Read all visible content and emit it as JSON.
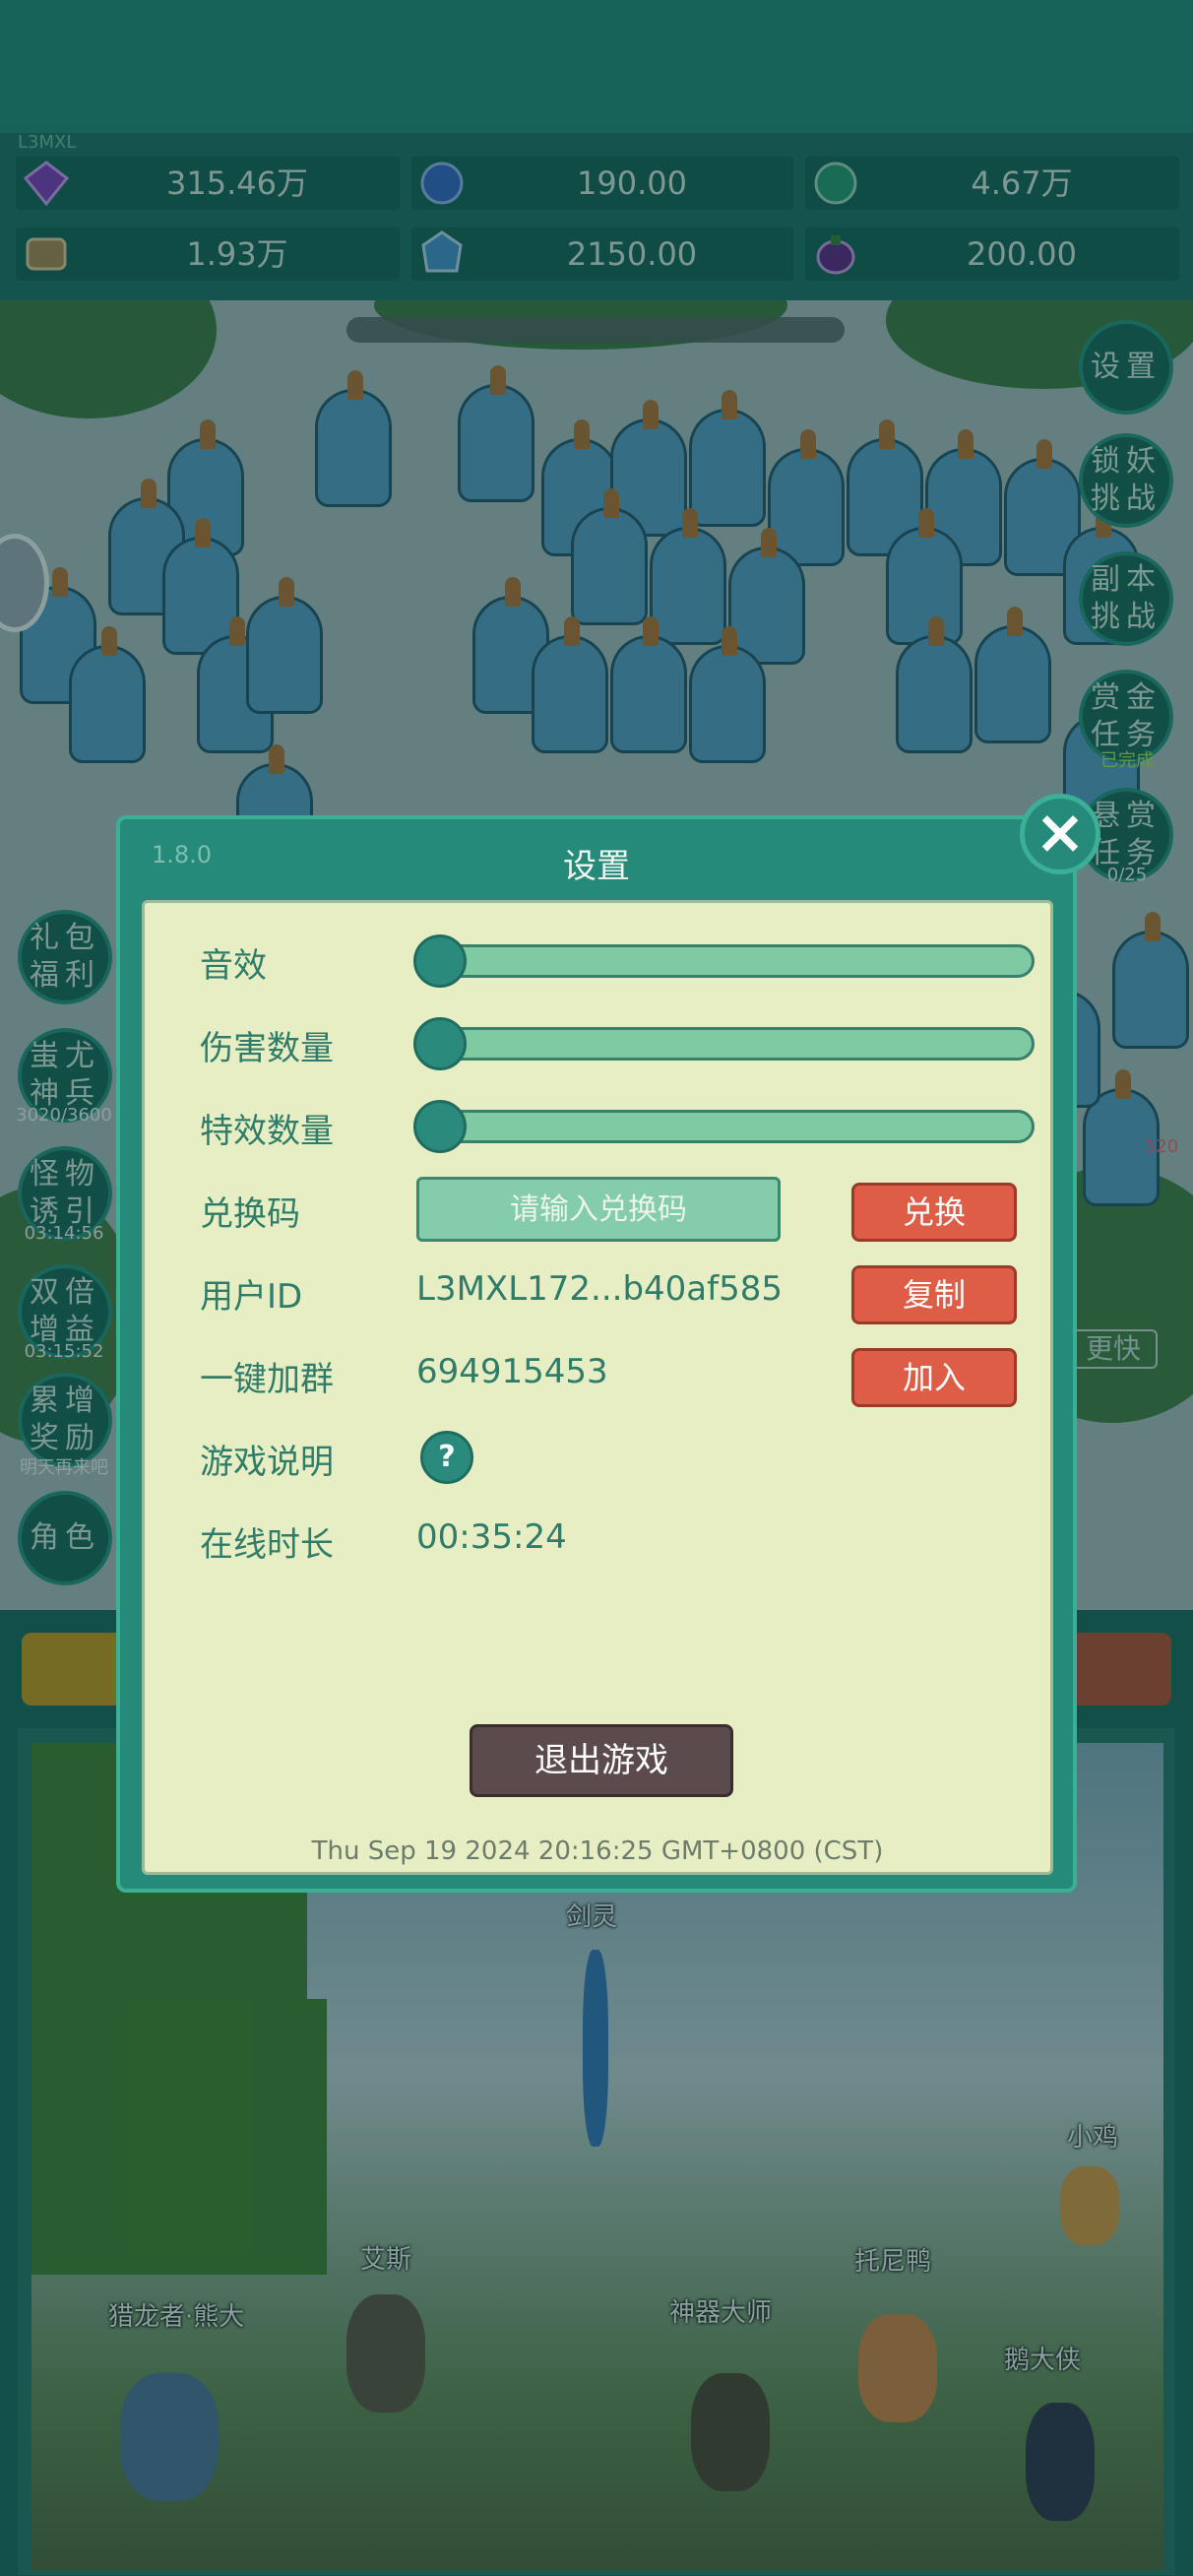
{
  "top": {
    "user_tag": "L3MXL",
    "resources": [
      {
        "name": "purple-gem",
        "value": "315.46万",
        "color": "#8a3fc7"
      },
      {
        "name": "blue-crystal",
        "value": "190.00",
        "color": "#3d6fd1"
      },
      {
        "name": "world-orb",
        "value": "4.67万",
        "color": "#2fa37a"
      },
      {
        "name": "scroll",
        "value": "1.93万",
        "color": "#b8905a"
      },
      {
        "name": "ice-crystal",
        "value": "2150.00",
        "color": "#4f9bd8"
      },
      {
        "name": "eggplant",
        "value": "200.00",
        "color": "#6a2a8a"
      }
    ]
  },
  "side_right": [
    {
      "label": "设置",
      "sub": ""
    },
    {
      "label": "锁妖挑战",
      "sub": ""
    },
    {
      "label": "副本挑战",
      "sub": ""
    },
    {
      "label": "赏金任务",
      "sub": "已完成"
    },
    {
      "label": "悬赏任务",
      "sub": "0/25"
    }
  ],
  "side_left": [
    {
      "label": "礼包福利",
      "sub": ""
    },
    {
      "label": "蚩尤神兵",
      "sub": "3020/3600"
    },
    {
      "label": "怪物诱引",
      "sub": "03:14:56"
    },
    {
      "label": "双倍增益",
      "sub": "03:15:52"
    },
    {
      "label": "累增奖励",
      "sub": "明天再来吧"
    },
    {
      "label": "角色",
      "sub": ""
    }
  ],
  "scene": {
    "right_number": "520",
    "speed_hint": "更快"
  },
  "heroes": [
    {
      "name": "剑灵"
    },
    {
      "name": "小鸡"
    },
    {
      "name": "艾斯"
    },
    {
      "name": "托尼鸭"
    },
    {
      "name": "猎龙者·熊大"
    },
    {
      "name": "神器大师"
    },
    {
      "name": "鹅大侠"
    }
  ],
  "settings": {
    "version": "1.8.0",
    "title": "设置",
    "sound_label": "音效",
    "sound_level": 0,
    "damage_label": "伤害数量",
    "damage_level": 0,
    "effect_label": "特效数量",
    "effect_level": 0,
    "redeem_label": "兑换码",
    "redeem_placeholder": "请输入兑换码",
    "redeem_button": "兑换",
    "userid_label": "用户ID",
    "userid_value": "L3MXL172...b40af585",
    "copy_button": "复制",
    "group_label": "一键加群",
    "group_value": "694915453",
    "join_button": "加入",
    "guide_label": "游戏说明",
    "guide_icon": "?",
    "online_label": "在线时长",
    "online_value": "00:35:24",
    "exit_button": "退出游戏",
    "timestamp": "Thu Sep 19 2024 20:16:25 GMT+0800 (CST)"
  }
}
